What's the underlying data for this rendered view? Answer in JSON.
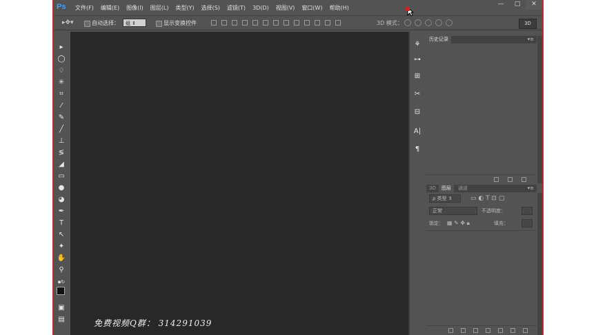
{
  "app": {
    "logo_text": "Ps",
    "menu": [
      "文件(F)",
      "编辑(E)",
      "图像(I)",
      "图层(L)",
      "类型(Y)",
      "选择(S)",
      "滤镜(T)",
      "3D(D)",
      "视图(V)",
      "窗口(W)",
      "帮助(H)"
    ],
    "window_controls": {
      "minimize": "—",
      "maximize": "□",
      "close": "✕"
    }
  },
  "options_bar": {
    "auto_select_label": "自动选择：",
    "auto_select_value": "组",
    "show_transform_label": "显示变换控件",
    "mode_3d_label": "3D 模式：",
    "btn_3d_label": "3D"
  },
  "panels": {
    "history": {
      "tab": "历史记录"
    },
    "layers": {
      "tabs": [
        "3D",
        "图层",
        "通道"
      ],
      "active_tab": "图层",
      "filter_label": "ρ 类型",
      "blend_mode": "正常",
      "opacity_label": "不透明度：",
      "lock_label": "锁定：",
      "fill_label": "填充："
    }
  },
  "watermark": "免费视频Q群： 314291039",
  "colors": {
    "accent_red": "#c8262b",
    "ps_blue": "#3fa1ff",
    "canvas": "#282828",
    "chrome": "#535353"
  }
}
